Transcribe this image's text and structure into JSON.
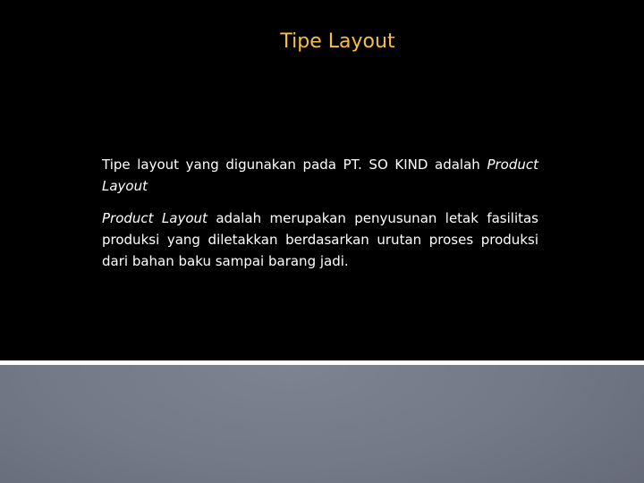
{
  "slide": {
    "title": "Tipe Layout",
    "title_color": "#f5c03a",
    "paragraphs": [
      {
        "text_plain": "Tipe layout yang digunakan pada PT. SO KIND adalah",
        "text_italic": "Product Layout"
      },
      {
        "text_italic": "Product Layout",
        "text_plain": " adalah merupakan penyusunan letak fasilitas produksi yang diletakkan berdasarkan urutan proses produksi dari bahan baku sampai barang jadi."
      }
    ]
  },
  "colors": {
    "background": "#000000",
    "body_text": "#ffffff",
    "divider": "#ffffff",
    "footer_gray": "#737987"
  }
}
